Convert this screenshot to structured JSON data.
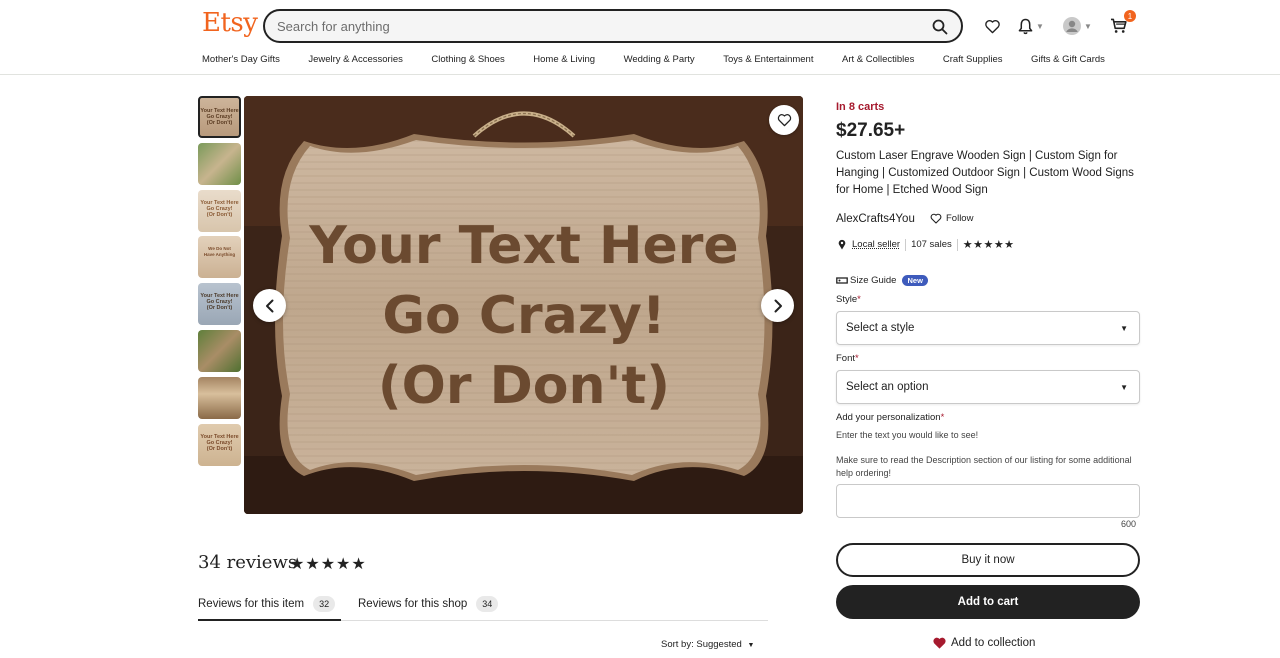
{
  "header": {
    "logo": "Etsy",
    "search_placeholder": "Search for anything",
    "cart_count": "1"
  },
  "categories": [
    "Mother's Day Gifts",
    "Jewelry & Accessories",
    "Clothing & Shoes",
    "Home & Living",
    "Wedding & Party",
    "Toys & Entertainment",
    "Art & Collectibles",
    "Craft Supplies",
    "Gifts & Gift Cards"
  ],
  "gallery": {
    "main_text": [
      "Your Text Here",
      "Go Crazy!",
      "(Or Don't)"
    ]
  },
  "product": {
    "in_carts": "In 8 carts",
    "price": "$27.65+",
    "title": "Custom Laser Engrave Wooden Sign | Custom Sign for Hanging | Customized Outdoor Sign | Custom Wood Signs for Home | Etched Wood Sign",
    "shop_name": "AlexCrafts4You",
    "follow": "Follow",
    "local_seller": "Local seller",
    "sales": "107 sales",
    "rating_stars": "★★★★★"
  },
  "options": {
    "size_guide": "Size Guide",
    "new_badge": "New",
    "style_label": "Style",
    "style_value": "Select a style",
    "font_label": "Font",
    "font_value": "Select an option",
    "personalization_label": "Add your personalization",
    "personalization_hint": "Enter the text you would like to see!",
    "personalization_note": "Make sure to read the Description section of our listing for some additional help ordering!",
    "char_counter": "600",
    "required_mark": "*"
  },
  "actions": {
    "buy_now": "Buy it now",
    "add_to_cart": "Add to cart",
    "add_to_collection": "Add to collection"
  },
  "reviews": {
    "title": "34 reviews",
    "stars": "★★★★★",
    "tab_item": "Reviews for this item",
    "tab_item_count": "32",
    "tab_shop": "Reviews for this shop",
    "tab_shop_count": "34",
    "sort_by": "Sort by: Suggested"
  },
  "colors": {
    "brand": "#f1641e",
    "in_carts": "#a61a2e",
    "new_badge": "#3e5bbc"
  }
}
